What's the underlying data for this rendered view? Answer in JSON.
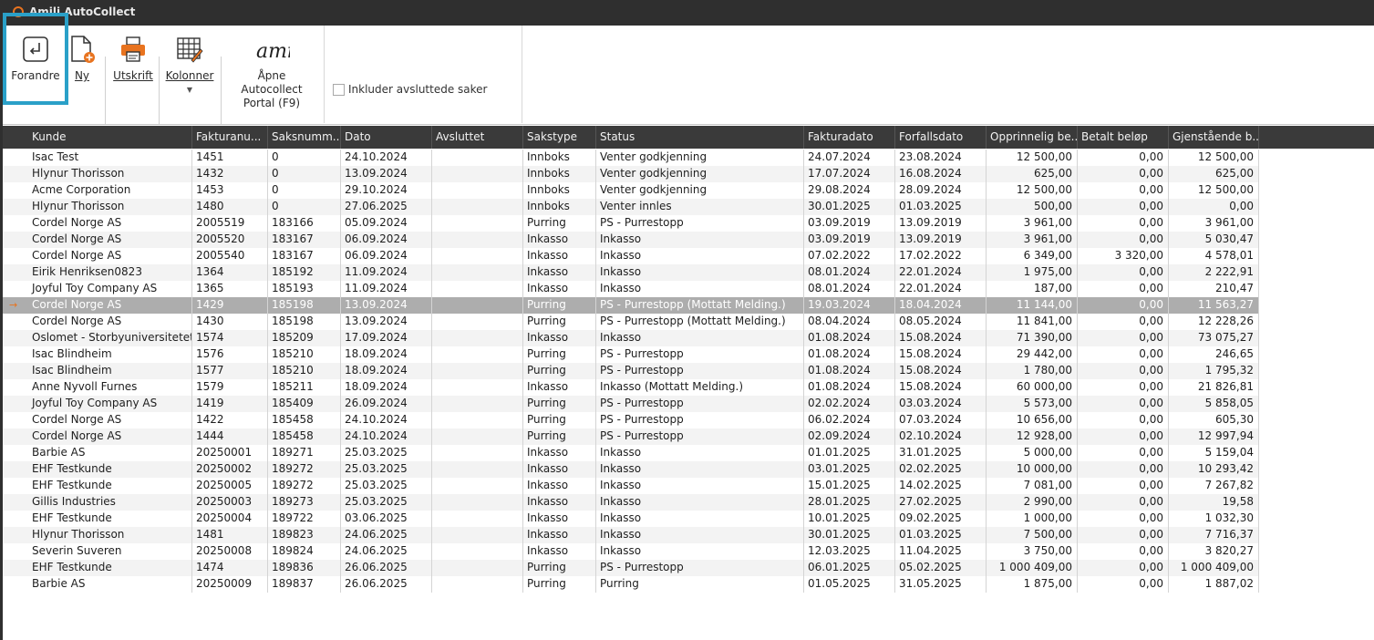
{
  "app": {
    "title": "Amili AutoCollect"
  },
  "toolbar": {
    "forandre": "Forandre",
    "ny": "Ny",
    "utskrift": "Utskrift",
    "kolonner": "Kolonner",
    "portal_line1": "Åpne Autocollect",
    "portal_line2": "Portal (F9)",
    "include_closed": "Inkluder avsluttede saker",
    "include_closed_checked": false
  },
  "table": {
    "columns": [
      "Kunde",
      "Fakturanu...",
      "Saksnumm...",
      "Dato",
      "Avsluttet",
      "Sakstype",
      "Status",
      "Fakturadato",
      "Forfallsdato",
      "Opprinnelig be...",
      "Betalt beløp",
      "Gjenstående b..."
    ],
    "selected_row": 9,
    "rows": [
      [
        "Isac Test",
        "1451",
        "0",
        "24.10.2024",
        "",
        "Innboks",
        "Venter godkjenning",
        "24.07.2024",
        "23.08.2024",
        "12 500,00",
        "0,00",
        "12 500,00"
      ],
      [
        "Hlynur Thorisson",
        "1432",
        "0",
        "13.09.2024",
        "",
        "Innboks",
        "Venter godkjenning",
        "17.07.2024",
        "16.08.2024",
        "625,00",
        "0,00",
        "625,00"
      ],
      [
        "Acme Corporation",
        "1453",
        "0",
        "29.10.2024",
        "",
        "Innboks",
        "Venter godkjenning",
        "29.08.2024",
        "28.09.2024",
        "12 500,00",
        "0,00",
        "12 500,00"
      ],
      [
        "Hlynur Thorisson",
        "1480",
        "0",
        "27.06.2025",
        "",
        "Innboks",
        "Venter innles",
        "30.01.2025",
        "01.03.2025",
        "500,00",
        "0,00",
        "0,00"
      ],
      [
        "Cordel Norge AS",
        "2005519",
        "183166",
        "05.09.2024",
        "",
        "Purring",
        "PS - Purrestopp",
        "03.09.2019",
        "13.09.2019",
        "3 961,00",
        "0,00",
        "3 961,00"
      ],
      [
        "Cordel Norge AS",
        "2005520",
        "183167",
        "06.09.2024",
        "",
        "Inkasso",
        "Inkasso",
        "03.09.2019",
        "13.09.2019",
        "3 961,00",
        "0,00",
        "5 030,47"
      ],
      [
        "Cordel Norge AS",
        "2005540",
        "183167",
        "06.09.2024",
        "",
        "Inkasso",
        "Inkasso",
        "07.02.2022",
        "17.02.2022",
        "6 349,00",
        "3 320,00",
        "4 578,01"
      ],
      [
        "Eirik Henriksen0823",
        "1364",
        "185192",
        "11.09.2024",
        "",
        "Inkasso",
        "Inkasso",
        "08.01.2024",
        "22.01.2024",
        "1 975,00",
        "0,00",
        "2 222,91"
      ],
      [
        "Joyful Toy Company AS",
        "1365",
        "185193",
        "11.09.2024",
        "",
        "Inkasso",
        "Inkasso",
        "08.01.2024",
        "22.01.2024",
        "187,00",
        "0,00",
        "210,47"
      ],
      [
        "Cordel Norge AS",
        "1429",
        "185198",
        "13.09.2024",
        "",
        "Purring",
        "PS - Purrestopp (Mottatt Melding.)",
        "19.03.2024",
        "18.04.2024",
        "11 144,00",
        "0,00",
        "11 563,27"
      ],
      [
        "Cordel Norge AS",
        "1430",
        "185198",
        "13.09.2024",
        "",
        "Purring",
        "PS - Purrestopp (Mottatt Melding.)",
        "08.04.2024",
        "08.05.2024",
        "11 841,00",
        "0,00",
        "12 228,26"
      ],
      [
        "Oslomet - Storbyuniversitetet",
        "1574",
        "185209",
        "17.09.2024",
        "",
        "Inkasso",
        "Inkasso",
        "01.08.2024",
        "15.08.2024",
        "71 390,00",
        "0,00",
        "73 075,27"
      ],
      [
        "Isac Blindheim",
        "1576",
        "185210",
        "18.09.2024",
        "",
        "Purring",
        "PS - Purrestopp",
        "01.08.2024",
        "15.08.2024",
        "29 442,00",
        "0,00",
        "246,65"
      ],
      [
        "Isac Blindheim",
        "1577",
        "185210",
        "18.09.2024",
        "",
        "Purring",
        "PS - Purrestopp",
        "01.08.2024",
        "15.08.2024",
        "1 780,00",
        "0,00",
        "1 795,32"
      ],
      [
        "Anne Nyvoll Furnes",
        "1579",
        "185211",
        "18.09.2024",
        "",
        "Inkasso",
        "Inkasso (Mottatt Melding.)",
        "01.08.2024",
        "15.08.2024",
        "60 000,00",
        "0,00",
        "21 826,81"
      ],
      [
        "Joyful Toy Company AS",
        "1419",
        "185409",
        "26.09.2024",
        "",
        "Purring",
        "PS - Purrestopp",
        "02.02.2024",
        "03.03.2024",
        "5 573,00",
        "0,00",
        "5 858,05"
      ],
      [
        "Cordel Norge AS",
        "1422",
        "185458",
        "24.10.2024",
        "",
        "Purring",
        "PS - Purrestopp",
        "06.02.2024",
        "07.03.2024",
        "10 656,00",
        "0,00",
        "605,30"
      ],
      [
        "Cordel Norge AS",
        "1444",
        "185458",
        "24.10.2024",
        "",
        "Purring",
        "PS - Purrestopp",
        "02.09.2024",
        "02.10.2024",
        "12 928,00",
        "0,00",
        "12 997,94"
      ],
      [
        "Barbie AS",
        "20250001",
        "189271",
        "25.03.2025",
        "",
        "Inkasso",
        "Inkasso",
        "01.01.2025",
        "31.01.2025",
        "5 000,00",
        "0,00",
        "5 159,04"
      ],
      [
        "EHF Testkunde",
        "20250002",
        "189272",
        "25.03.2025",
        "",
        "Inkasso",
        "Inkasso",
        "03.01.2025",
        "02.02.2025",
        "10 000,00",
        "0,00",
        "10 293,42"
      ],
      [
        "EHF Testkunde",
        "20250005",
        "189272",
        "25.03.2025",
        "",
        "Inkasso",
        "Inkasso",
        "15.01.2025",
        "14.02.2025",
        "7 081,00",
        "0,00",
        "7 267,82"
      ],
      [
        "Gillis Industries",
        "20250003",
        "189273",
        "25.03.2025",
        "",
        "Inkasso",
        "Inkasso",
        "28.01.2025",
        "27.02.2025",
        "2 990,00",
        "0,00",
        "19,58"
      ],
      [
        "EHF Testkunde",
        "20250004",
        "189722",
        "03.06.2025",
        "",
        "Inkasso",
        "Inkasso",
        "10.01.2025",
        "09.02.2025",
        "1 000,00",
        "0,00",
        "1 032,30"
      ],
      [
        "Hlynur Thorisson",
        "1481",
        "189823",
        "24.06.2025",
        "",
        "Inkasso",
        "Inkasso",
        "30.01.2025",
        "01.03.2025",
        "7 500,00",
        "0,00",
        "7 716,37"
      ],
      [
        "Severin Suveren",
        "20250008",
        "189824",
        "24.06.2025",
        "",
        "Inkasso",
        "Inkasso",
        "12.03.2025",
        "11.04.2025",
        "3 750,00",
        "0,00",
        "3 820,27"
      ],
      [
        "EHF Testkunde",
        "1474",
        "189836",
        "26.06.2025",
        "",
        "Purring",
        "PS - Purrestopp",
        "06.01.2025",
        "05.02.2025",
        "1 000 409,00",
        "0,00",
        "1 000 409,00"
      ],
      [
        "Barbie AS",
        "20250009",
        "189837",
        "26.06.2025",
        "",
        "Purring",
        "Purring",
        "01.05.2025",
        "31.05.2025",
        "1 875,00",
        "0,00",
        "1 887,02"
      ]
    ]
  },
  "colors": {
    "accent": "#e8731f",
    "highlight": "#2aa0c8",
    "selected_row": "#adadad",
    "header_bg": "#3a3a3a"
  }
}
